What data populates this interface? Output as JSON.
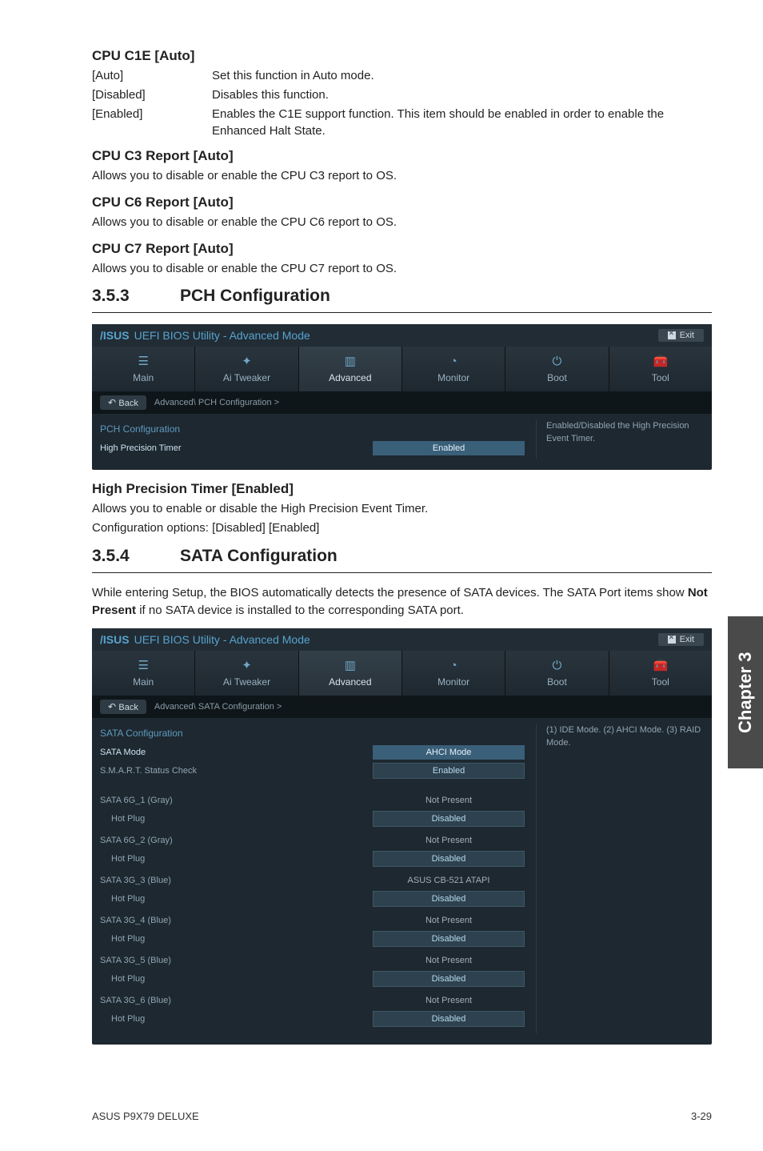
{
  "sections": {
    "c1e": {
      "title": "CPU C1E [Auto]",
      "rows": [
        {
          "key": "[Auto]",
          "val": "Set this function in Auto mode."
        },
        {
          "key": "[Disabled]",
          "val": "Disables this function."
        },
        {
          "key": "[Enabled]",
          "val": "Enables the C1E support function. This item should be enabled in order to enable the Enhanced Halt State."
        }
      ]
    },
    "c3": {
      "title": "CPU C3 Report [Auto]",
      "text": "Allows you to disable or enable the CPU C3 report to OS."
    },
    "c6": {
      "title": "CPU C6 Report [Auto]",
      "text": "Allows you to disable or enable the CPU C6 report to OS."
    },
    "c7": {
      "title": "CPU C7 Report [Auto]",
      "text": "Allows you to disable or enable the CPU C7 report to OS."
    }
  },
  "h353": {
    "num": "3.5.3",
    "title": "PCH Configuration"
  },
  "h354": {
    "num": "3.5.4",
    "title": "SATA Configuration"
  },
  "hpt": {
    "title": "High Precision Timer [Enabled]",
    "text1": "Allows you to enable or disable the High Precision Event Timer.",
    "text2": "Configuration options: [Disabled] [Enabled]"
  },
  "sata_intro": {
    "text_a": "While entering Setup, the BIOS automatically detects the presence of SATA devices. The SATA Port items show ",
    "bold": "Not Present",
    "text_b": " if no SATA device is installed to the corresponding SATA port."
  },
  "bios_common": {
    "logo": "/ISUS",
    "title": "UEFI BIOS Utility - Advanced Mode",
    "exit": "Exit",
    "back": "Back",
    "tabs": {
      "main": "Main",
      "ai": "Ai  Tweaker",
      "adv": "Advanced",
      "mon": "Monitor",
      "boot": "Boot",
      "tool": "Tool"
    }
  },
  "bios1": {
    "crumb": "Advanced\\ PCH Configuration  >",
    "section": "PCH Configuration",
    "item_label": "High Precision Timer",
    "item_val": "Enabled",
    "help": "Enabled/Disabled the High Precision Event Timer."
  },
  "bios2": {
    "crumb": "Advanced\\ SATA Configuration  >",
    "section": "SATA Configuration",
    "help": "(1) IDE Mode. (2) AHCI Mode. (3) RAID Mode.",
    "items": [
      {
        "label": "SATA Mode",
        "val": "AHCI Mode",
        "style": "sel",
        "high": true
      },
      {
        "label": "S.M.A.R.T. Status Check",
        "val": "Enabled",
        "style": "box"
      }
    ],
    "ports": [
      {
        "name": "SATA 6G_1 (Gray)",
        "val": "Not Present",
        "hot": "Disabled"
      },
      {
        "name": "SATA 6G_2 (Gray)",
        "val": "Not Present",
        "hot": "Disabled"
      },
      {
        "name": "SATA 3G_3 (Blue)",
        "val": "ASUS   CB-521 ATAPI",
        "hot": "Disabled"
      },
      {
        "name": "SATA 3G_4 (Blue)",
        "val": "Not Present",
        "hot": "Disabled"
      },
      {
        "name": "SATA 3G_5 (Blue)",
        "val": "Not Present",
        "hot": "Disabled"
      },
      {
        "name": "SATA 3G_6 (Blue)",
        "val": "Not Present",
        "hot": "Disabled"
      }
    ],
    "hot_label": "Hot Plug"
  },
  "chapter_tab": "Chapter 3",
  "footer": {
    "left": "ASUS P9X79 DELUXE",
    "right": "3-29"
  }
}
